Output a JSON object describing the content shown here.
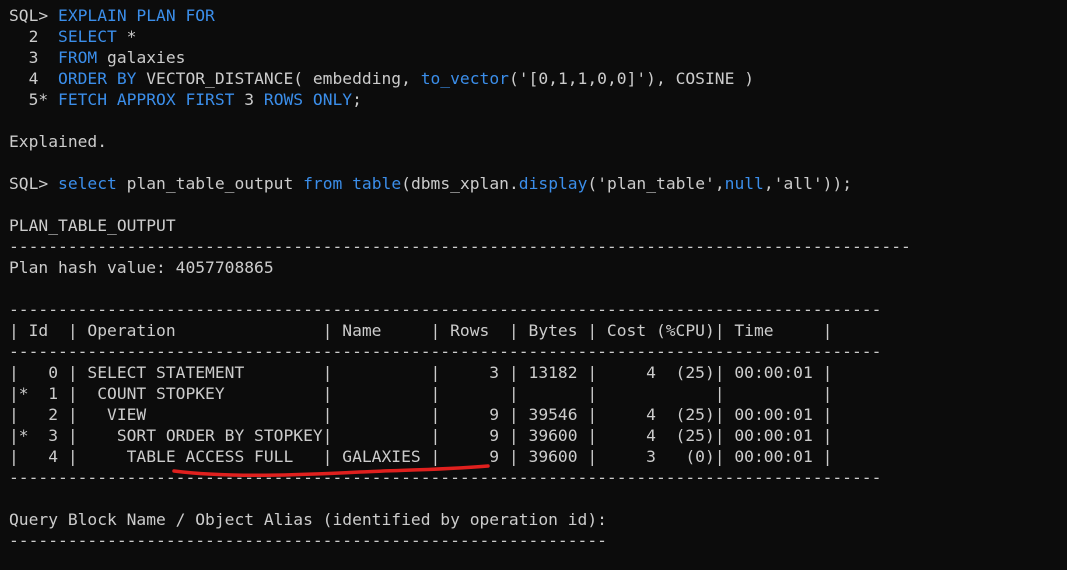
{
  "terminal": {
    "lines": [
      [
        {
          "t": "SQL> "
        },
        {
          "t": "EXPLAIN PLAN FOR",
          "c": "kw"
        }
      ],
      [
        {
          "t": "  2  "
        },
        {
          "t": "SELECT",
          "c": "kw"
        },
        {
          "t": " *"
        }
      ],
      [
        {
          "t": "  3  "
        },
        {
          "t": "FROM",
          "c": "kw"
        },
        {
          "t": " galaxies"
        }
      ],
      [
        {
          "t": "  4  "
        },
        {
          "t": "ORDER BY",
          "c": "kw"
        },
        {
          "t": " VECTOR_DISTANCE( embedding, "
        },
        {
          "t": "to_vector",
          "c": "fn"
        },
        {
          "t": "('[0,1,1,0,0]'), COSINE )"
        }
      ],
      [
        {
          "t": "  5* "
        },
        {
          "t": "FETCH APPROX FIRST",
          "c": "kw"
        },
        {
          "t": " 3 "
        },
        {
          "t": "ROWS ONLY",
          "c": "kw"
        },
        {
          "t": ";"
        }
      ],
      [],
      [
        {
          "t": "Explained."
        }
      ],
      [],
      [
        {
          "t": "SQL> "
        },
        {
          "t": "select",
          "c": "kw"
        },
        {
          "t": " plan_table_output "
        },
        {
          "t": "from",
          "c": "kw"
        },
        {
          "t": " "
        },
        {
          "t": "table",
          "c": "fn"
        },
        {
          "t": "(dbms_xplan."
        },
        {
          "t": "display",
          "c": "fn"
        },
        {
          "t": "('plan_table',"
        },
        {
          "t": "null",
          "c": "kw"
        },
        {
          "t": ",'all'));"
        }
      ],
      [],
      [
        {
          "t": "PLAN_TABLE_OUTPUT"
        }
      ],
      [
        {
          "t": "--------------------------------------------------------------------------------------------"
        }
      ],
      [
        {
          "t": "Plan hash value: 4057708865"
        }
      ],
      [],
      [
        {
          "t": "-----------------------------------------------------------------------------------------"
        }
      ],
      [
        {
          "t": "| Id  | Operation               | Name     | Rows  | Bytes | Cost (%CPU)| Time     |"
        }
      ],
      [
        {
          "t": "-----------------------------------------------------------------------------------------"
        }
      ],
      [
        {
          "t": "|   0 | SELECT STATEMENT        |          |     3 | 13182 |     4  (25)| 00:00:01 |"
        }
      ],
      [
        {
          "t": "|*  1 |  COUNT STOPKEY          |          |       |       |            |          |"
        }
      ],
      [
        {
          "t": "|   2 |   VIEW                  |          |     9 | 39546 |     4  (25)| 00:00:01 |"
        }
      ],
      [
        {
          "t": "|*  3 |    SORT ORDER BY STOPKEY|          |     9 | 39600 |     4  (25)| 00:00:01 |"
        }
      ],
      [
        {
          "t": "|   4 |     TABLE ACCESS FULL   | GALAXIES |     9 | 39600 |     3   (0)| 00:00:01 |"
        }
      ],
      [
        {
          "t": "-----------------------------------------------------------------------------------------"
        }
      ],
      [],
      [
        {
          "t": "Query Block Name / Object Alias (identified by operation id):"
        }
      ],
      [
        {
          "t": "-------------------------------------------------------------"
        }
      ]
    ]
  },
  "colors": {
    "background": "#0c0c0c",
    "text": "#cccccc",
    "keyword": "#3b8eea",
    "annotation": "#e0201e"
  }
}
